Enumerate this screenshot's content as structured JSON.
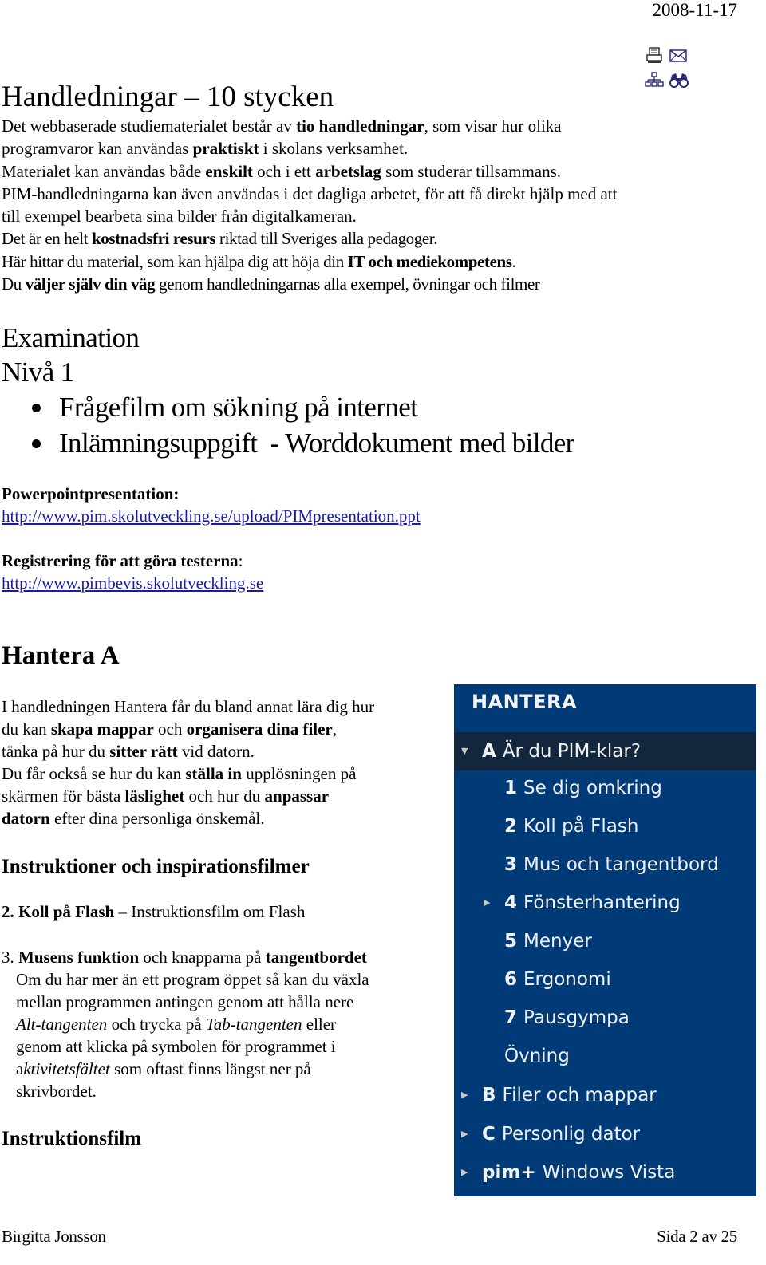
{
  "header": {
    "date": "2008-11-17"
  },
  "toolbar_icons": [
    "print-icon",
    "mail-icon",
    "sitemap-icon",
    "binoculars-icon"
  ],
  "intro": {
    "title": "Handledningar – 10 stycken",
    "lines": [
      [
        {
          "t": "Det webbaserade studiematerialet består av "
        },
        {
          "t": "tio handledningar",
          "b": true
        },
        {
          "t": ", som visar hur olika"
        }
      ],
      [
        {
          "t": "programvaror kan användas "
        },
        {
          "t": "praktiskt",
          "b": true
        },
        {
          "t": " i skolans verksamhet."
        }
      ],
      [
        {
          "t": "Materialet kan användas både "
        },
        {
          "t": "enskilt",
          "b": true
        },
        {
          "t": " och i ett "
        },
        {
          "t": "arbetslag",
          "b": true
        },
        {
          "t": " som studerar tillsammans."
        }
      ],
      [
        {
          "t": "PIM-handledningarna kan även användas i det dagliga arbetet, för att få direkt hjälp med att"
        }
      ],
      [
        {
          "t": "till exempel bearbeta sina bilder från digitalkameran."
        }
      ],
      [
        {
          "t": "Det är en helt "
        },
        {
          "t": "kostnadsfri resurs",
          "b": true
        },
        {
          "t": " riktad till Sveriges alla pedagoger."
        }
      ],
      [
        {
          "t": "Här hittar du material, som kan hjälpa dig att höja din "
        },
        {
          "t": "IT och mediekompetens",
          "b": true
        },
        {
          "t": "."
        }
      ],
      [
        {
          "t": "Du "
        },
        {
          "t": "väljer själv din väg",
          "b": true
        },
        {
          "t": " genom handledningarnas alla exempel, övningar och filmer"
        }
      ]
    ]
  },
  "examination": {
    "heading": "Examination",
    "level": "Nivå 1",
    "items": [
      "Frågefilm om sökning på internet",
      "Inlämningsuppgift  - Worddokument med bilder"
    ]
  },
  "links": {
    "powerpoint_label": "Powerpointpresentation:",
    "powerpoint_url": "http://www.pim.skolutveckling.se/upload/PIMpresentation.ppt",
    "registration_label": "Registrering för att göra testerna",
    "registration_colon": ":",
    "registration_url": "http://www.pimbevis.skolutveckling.se"
  },
  "hantera": {
    "heading": "Hantera A",
    "lines": [
      [
        {
          "t": "I handledningen Hantera får du bland annat lära dig hur"
        }
      ],
      [
        {
          "t": "du kan "
        },
        {
          "t": "skapa mappar",
          "b": true
        },
        {
          "t": " och "
        },
        {
          "t": "organisera dina filer",
          "b": true
        },
        {
          "t": ","
        }
      ],
      [
        {
          "t": "tänka på hur du "
        },
        {
          "t": "sitter rätt",
          "b": true
        },
        {
          "t": " vid datorn."
        }
      ],
      [
        {
          "t": "Du får också se hur du kan "
        },
        {
          "t": "ställa in",
          "b": true
        },
        {
          "t": " upplösningen på"
        }
      ],
      [
        {
          "t": "skärmen för bästa "
        },
        {
          "t": "läslighet",
          "b": true
        },
        {
          "t": " och hur du "
        },
        {
          "t": "anpassar",
          "b": true
        }
      ],
      [
        {
          "t": "datorn",
          "b": true
        },
        {
          "t": " efter dina personliga önskemål."
        }
      ]
    ],
    "instructions_heading": "Instruktioner och inspirationsfilmer",
    "item2": [
      {
        "t": "2. Koll på Flash",
        "b": true
      },
      {
        "t": " – Instruktionsfilm om Flash"
      }
    ],
    "item3": [
      {
        "t": "3. "
      },
      {
        "t": "Musens funktion",
        "b": true
      },
      {
        "t": " och knapparna på "
      },
      {
        "t": "tangentbordet",
        "b": true
      }
    ],
    "item3_body": [
      [
        {
          "t": "Om du har mer än ett program öppet så kan du växla"
        }
      ],
      [
        {
          "t": "mellan programmen antingen genom att hålla nere"
        }
      ],
      [
        {
          "t": "Alt-tangenten",
          "i": true
        },
        {
          "t": " och trycka på "
        },
        {
          "t": "Tab-tangenten",
          "i": true
        },
        {
          "t": " eller"
        }
      ],
      [
        {
          "t": "genom att klicka på symbolen för programmet i"
        }
      ],
      [
        {
          "t": "a"
        },
        {
          "t": "ktivitetsfältet",
          "i": true
        },
        {
          "t": " som oftast finns längst ner på"
        }
      ],
      [
        {
          "t": "skrivbordet."
        }
      ]
    ],
    "film_heading": "Instruktionsfilm"
  },
  "menu": {
    "colors": {
      "background": "#003b78",
      "selected": "#12263d",
      "text": "#f1f1f1"
    },
    "heading": "HANTERA",
    "items": [
      {
        "key": "A",
        "label": "Är du PIM-klar?",
        "level": "top",
        "arrow": "down",
        "selected": true
      },
      {
        "key": "1",
        "label": "Se dig omkring",
        "level": "sub",
        "arrow": ""
      },
      {
        "key": "2",
        "label": "Koll på Flash",
        "level": "sub",
        "arrow": ""
      },
      {
        "key": "3",
        "label": "Mus och tangentbord",
        "level": "sub",
        "arrow": ""
      },
      {
        "key": "4",
        "label": "Fönsterhantering",
        "level": "sub",
        "arrow": "right"
      },
      {
        "key": "5",
        "label": "Menyer",
        "level": "sub",
        "arrow": ""
      },
      {
        "key": "6",
        "label": "Ergonomi",
        "level": "sub",
        "arrow": ""
      },
      {
        "key": "7",
        "label": "Pausgympa",
        "level": "sub",
        "arrow": ""
      },
      {
        "key": "",
        "label": "Övning",
        "level": "sub",
        "arrow": ""
      },
      {
        "key": "B",
        "label": "Filer och mappar",
        "level": "top",
        "arrow": "right"
      },
      {
        "key": "C",
        "label": "Personlig dator",
        "level": "top",
        "arrow": "right"
      },
      {
        "key": "pim+",
        "label": "Windows Vista",
        "level": "top",
        "arrow": "right"
      }
    ]
  },
  "footer": {
    "author": "Birgitta Jonsson",
    "page": "Sida 2 av 25"
  }
}
